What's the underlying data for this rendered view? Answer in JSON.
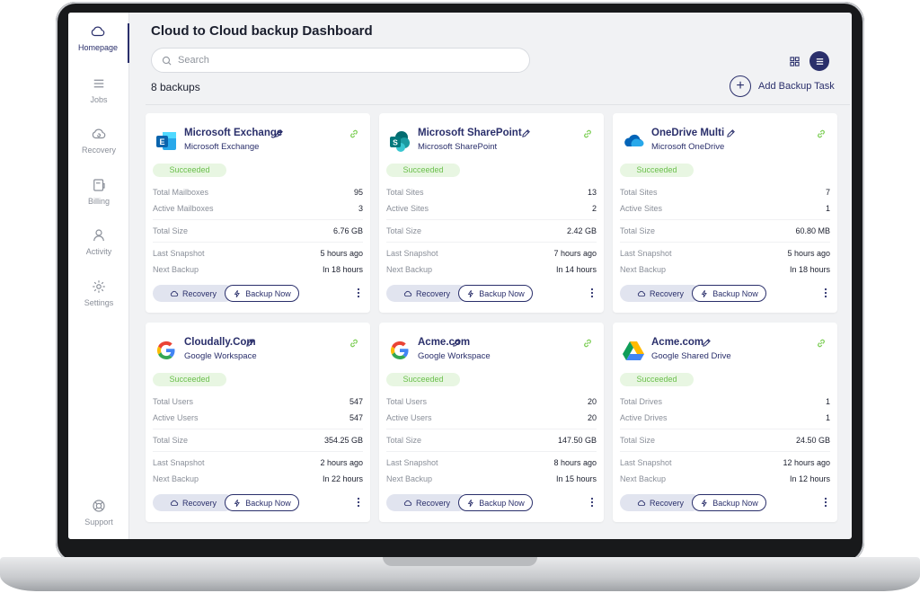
{
  "header": {
    "title": "Cloud to Cloud backup Dashboard",
    "search_placeholder": "Search",
    "backup_count": "8 backups",
    "add_task_label": "Add Backup Task"
  },
  "sidebar": {
    "items": [
      {
        "label": "Homepage",
        "icon": "cloud-icon",
        "active": true
      },
      {
        "label": "Jobs",
        "icon": "list-icon",
        "active": false
      },
      {
        "label": "Recovery",
        "icon": "cloud-restore-icon",
        "active": false
      },
      {
        "label": "Billing",
        "icon": "billing-icon",
        "active": false
      },
      {
        "label": "Activity",
        "icon": "user-icon",
        "active": false
      },
      {
        "label": "Settings",
        "icon": "gear-icon",
        "active": false
      }
    ],
    "support_label": "Support"
  },
  "colors": {
    "accent": "#2a2f6b",
    "success_bg": "#e8f6e2",
    "success_text": "#6abf4b",
    "link": "#7fcf59"
  },
  "buttons": {
    "recovery": "Recovery",
    "backup_now": "Backup Now"
  },
  "cards": [
    {
      "name": "Microsoft Exchange",
      "service": "Microsoft Exchange",
      "logo": "exchange-logo",
      "status": "Succeeded",
      "stat1_label": "Total Mailboxes",
      "stat1_value": "95",
      "stat2_label": "Active Mailboxes",
      "stat2_value": "3",
      "size_label": "Total Size",
      "size_value": "6.76 GB",
      "snapshot_label": "Last Snapshot",
      "snapshot_value": "5 hours ago",
      "next_label": "Next Backup",
      "next_value": "In 18 hours"
    },
    {
      "name": "Microsoft SharePoint",
      "service": "Microsoft SharePoint",
      "logo": "sharepoint-logo",
      "status": "Succeeded",
      "stat1_label": "Total Sites",
      "stat1_value": "13",
      "stat2_label": "Active Sites",
      "stat2_value": "2",
      "size_label": "Total Size",
      "size_value": "2.42 GB",
      "snapshot_label": "Last Snapshot",
      "snapshot_value": "7 hours ago",
      "next_label": "Next Backup",
      "next_value": "In 14 hours"
    },
    {
      "name": "OneDrive Multi",
      "service": "Microsoft OneDrive",
      "logo": "onedrive-logo",
      "status": "Succeeded",
      "stat1_label": "Total Sites",
      "stat1_value": "7",
      "stat2_label": "Active Sites",
      "stat2_value": "1",
      "size_label": "Total Size",
      "size_value": "60.80 MB",
      "snapshot_label": "Last Snapshot",
      "snapshot_value": "5 hours ago",
      "next_label": "Next Backup",
      "next_value": "In 18 hours"
    },
    {
      "name": "Cloudally.Com",
      "service": "Google Workspace",
      "logo": "google-logo",
      "status": "Succeeded",
      "stat1_label": "Total Users",
      "stat1_value": "547",
      "stat2_label": "Active Users",
      "stat2_value": "547",
      "size_label": "Total Size",
      "size_value": "354.25 GB",
      "snapshot_label": "Last Snapshot",
      "snapshot_value": "2 hours ago",
      "next_label": "Next Backup",
      "next_value": "In 22 hours"
    },
    {
      "name": "Acme.com",
      "service": "Google Workspace",
      "logo": "google-logo",
      "status": "Succeeded",
      "stat1_label": "Total Users",
      "stat1_value": "20",
      "stat2_label": "Active Users",
      "stat2_value": "20",
      "size_label": "Total Size",
      "size_value": "147.50 GB",
      "snapshot_label": "Last Snapshot",
      "snapshot_value": "8 hours ago",
      "next_label": "Next Backup",
      "next_value": "In 15 hours"
    },
    {
      "name": "Acme.com",
      "service": "Google Shared Drive",
      "logo": "google-drive-logo",
      "status": "Succeeded",
      "stat1_label": "Total Drives",
      "stat1_value": "1",
      "stat2_label": "Active Drives",
      "stat2_value": "1",
      "size_label": "Total Size",
      "size_value": "24.50 GB",
      "snapshot_label": "Last Snapshot",
      "snapshot_value": "12 hours ago",
      "next_label": "Next Backup",
      "next_value": "In 12 hours"
    }
  ]
}
